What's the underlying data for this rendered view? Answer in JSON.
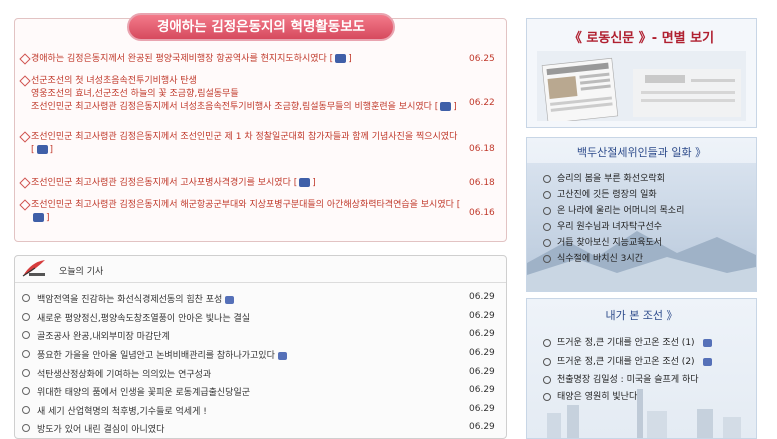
{
  "panel1": {
    "title": "경애하는 김정은동지의 혁명활동보도",
    "items": [
      {
        "text": "경애하는 김정은동지께서 완공된 평양국제비행장 항공역사를 현지지도하시였다  [",
        "tail": "]",
        "date": "06.25"
      },
      {
        "text": "선군조선의 첫 녀성초음속전투기비행사 탄생\n영웅조선의 효녀,선군조선 하늘의 꽃 조금향,림설동무들\n조선인민군 최고사령관 김정은동지께서 녀성초음속전투기비행사 조금향,림설동무들의 비행훈련을 보시였다  [",
        "tail": "]",
        "date": "06.22"
      },
      {
        "text": "조선인민군 최고사령관 김정은동지께서 조선인민군 제 1 차 정찰일군대회 참가자들과 함께 기념사진을 찍으시였다  [",
        "tail": "]",
        "date": "06.18"
      },
      {
        "text": "조선인민군 최고사령관 김정은동지께서 고사포병사격경기를 보시였다  [",
        "tail": "]",
        "date": "06.18"
      },
      {
        "text": "조선인민군 최고사령관 김정은동지께서 해군항공군부대와 지상포병구분대들의 아간해상화력타격연습을 보시였다  [",
        "tail": "]",
        "date": "06.16"
      }
    ]
  },
  "panel2": {
    "title": "오늘의 기사",
    "items": [
      {
        "text": "백암전역을 진감하는 화선식경제선동의 힘찬 포성",
        "camera": true,
        "date": "06.29"
      },
      {
        "text": "새로운 평양정신,평양속도창조열풍이 안아온 빛나는 결실",
        "camera": false,
        "date": "06.29"
      },
      {
        "text": "골조공사 완공,내외부미장 마감단계",
        "camera": false,
        "date": "06.29"
      },
      {
        "text": "풍요한 가을을 안아올 일념안고 논벼비배관리를 참하나가고있다",
        "camera": true,
        "date": "06.29"
      },
      {
        "text": "석탄생산정상화에 기여하는 의의있는 연구성과",
        "camera": false,
        "date": "06.29"
      },
      {
        "text": "위대한 태양의 품에서 인생을 꽃피운 로동계급출신당일군",
        "camera": false,
        "date": "06.29"
      },
      {
        "text": "새 세기 산업혁명의 척후병,기수들로 억세게 !",
        "camera": false,
        "date": "06.29"
      },
      {
        "text": "방도가 있어 내린 결심이 아니였다",
        "camera": false,
        "date": "06.29"
      }
    ]
  },
  "right1": {
    "title": "《 로동신문 》- 면별 보기"
  },
  "right2": {
    "title": "백두산절세위인들과 일화  》",
    "items": [
      "승리의 봄을 부른 화선오락회",
      "고산진에 깃든 령장의 일화",
      "온 나라에 울리는 어머니의 목소리",
      "우리 원수님과 녀자탁구선수",
      "거듭 찾아보신 지능교육도서",
      "식수절에 바치신 3시간"
    ]
  },
  "right3": {
    "title": "내가 본 조선       》",
    "items": [
      {
        "text": "뜨거운 정,큰 기대를 안고온 조선 (1)",
        "camera": true
      },
      {
        "text": "뜨거운 정,큰 기대를 안고온 조선 (2)",
        "camera": true
      },
      {
        "text": "천출명장 김일성 : 미국을 슬프게 하다",
        "camera": false
      },
      {
        "text": "태양은 영원히 빛난다",
        "camera": false
      }
    ]
  }
}
